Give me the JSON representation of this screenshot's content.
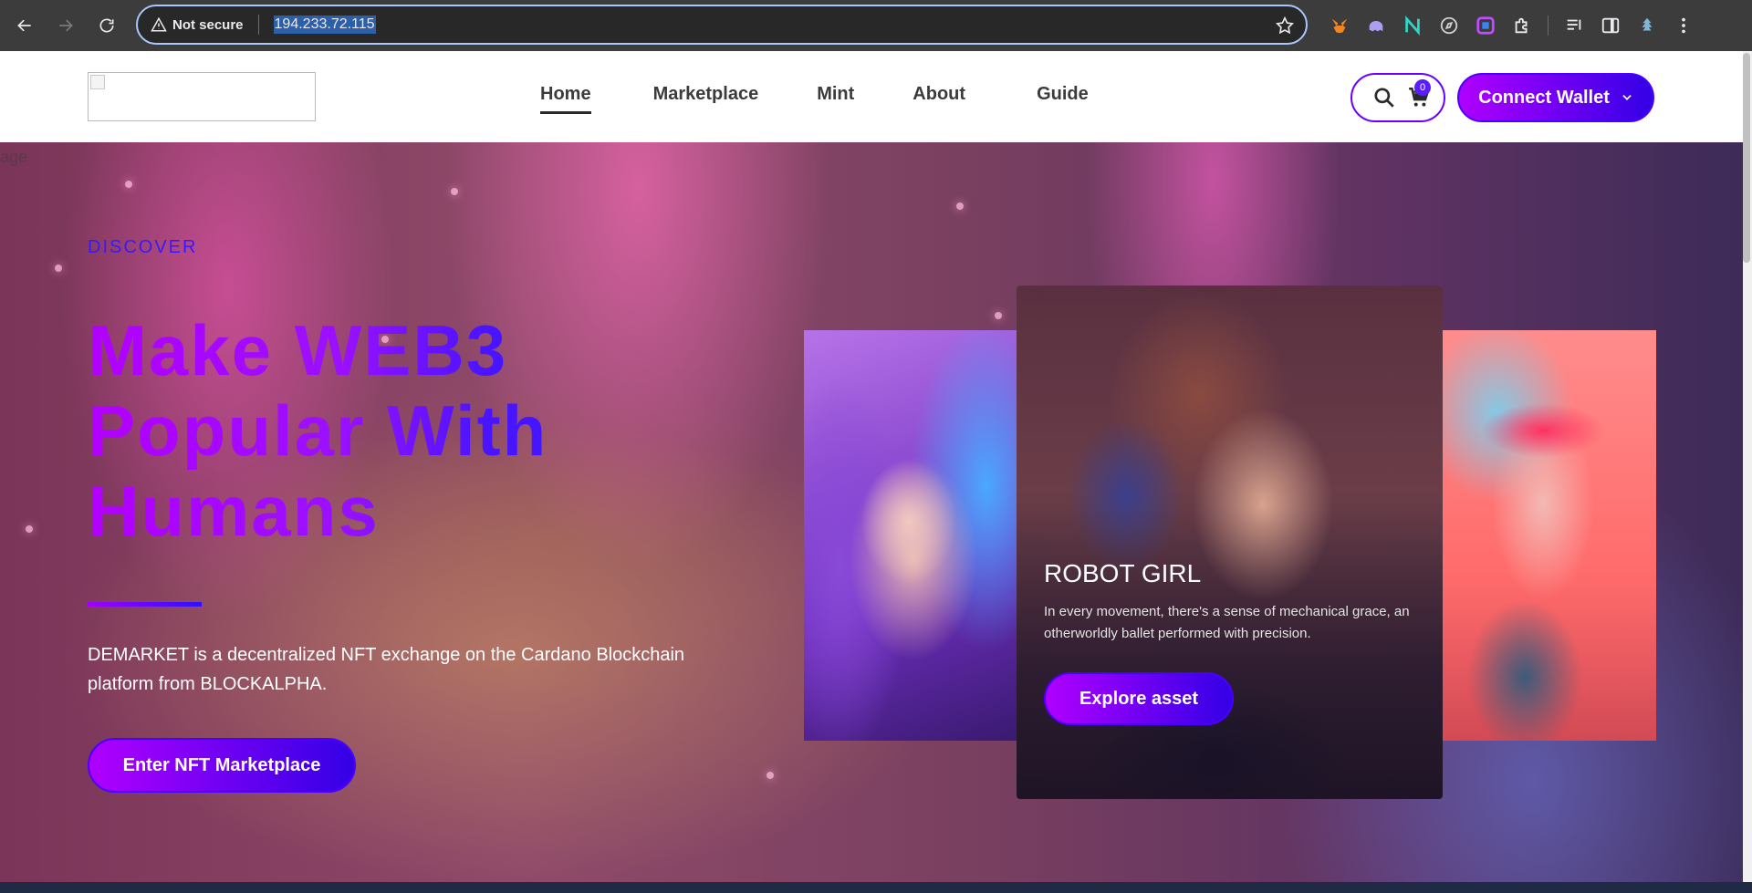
{
  "browser": {
    "security_label": "Not secure",
    "url": "194.233.72.115"
  },
  "header": {
    "nav": [
      "Home",
      "Marketplace",
      "Mint",
      "About",
      "Guide"
    ],
    "active": "Home",
    "cart_count": "0",
    "wallet_button": "Connect Wallet"
  },
  "hero": {
    "image_alt_fragment": "age",
    "eyebrow": "DISCOVER",
    "headline": "Make WEB3 Popular With Humans",
    "description": "DEMARKET is a decentralized NFT exchange on the Cardano Blockchain platform from BLOCKALPHA.",
    "cta": "Enter NFT Marketplace"
  },
  "carousel": {
    "active_title": "ROBOT GIRL",
    "active_description": "In every movement, there's a sense of mechanical grace, an otherworldly ballet performed with precision.",
    "explore_button": "Explore asset"
  },
  "colors": {
    "brand_purple": "#b000ff",
    "brand_blue": "#3300e6"
  }
}
